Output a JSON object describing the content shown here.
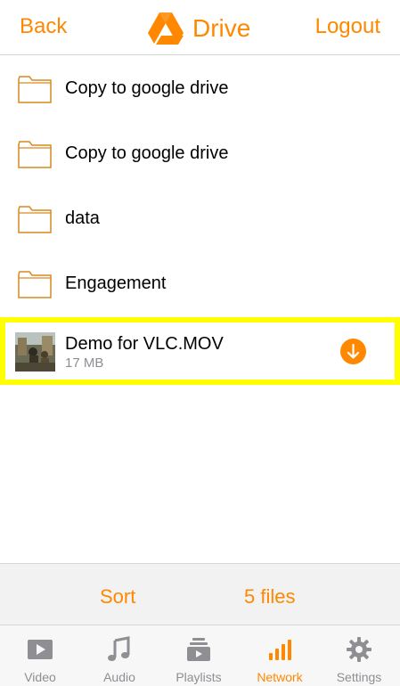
{
  "colors": {
    "accent": "#ff8800",
    "highlight": "#ffff00",
    "tab_inactive": "#8e8e93"
  },
  "navbar": {
    "back_label": "Back",
    "title": "Drive",
    "logout_label": "Logout",
    "logo_icon": "google-drive-icon"
  },
  "items": [
    {
      "type": "folder",
      "label": "Copy to google drive",
      "icon": "folder-icon"
    },
    {
      "type": "folder",
      "label": "Copy to google drive",
      "icon": "folder-icon"
    },
    {
      "type": "folder",
      "label": "data",
      "icon": "folder-icon"
    },
    {
      "type": "folder",
      "label": "Engagement",
      "icon": "folder-icon"
    }
  ],
  "file": {
    "name": "Demo for VLC.MOV",
    "size": "17 MB",
    "highlighted": true,
    "action_icon": "download-icon"
  },
  "footer": {
    "sort_label": "Sort",
    "count_label": "5 files"
  },
  "tabs": [
    {
      "label": "Video",
      "icon": "video-icon",
      "active": false
    },
    {
      "label": "Audio",
      "icon": "music-note-icon",
      "active": false
    },
    {
      "label": "Playlists",
      "icon": "playlist-icon",
      "active": false
    },
    {
      "label": "Network",
      "icon": "signal-bars-icon",
      "active": true
    },
    {
      "label": "Settings",
      "icon": "gear-icon",
      "active": false
    }
  ]
}
